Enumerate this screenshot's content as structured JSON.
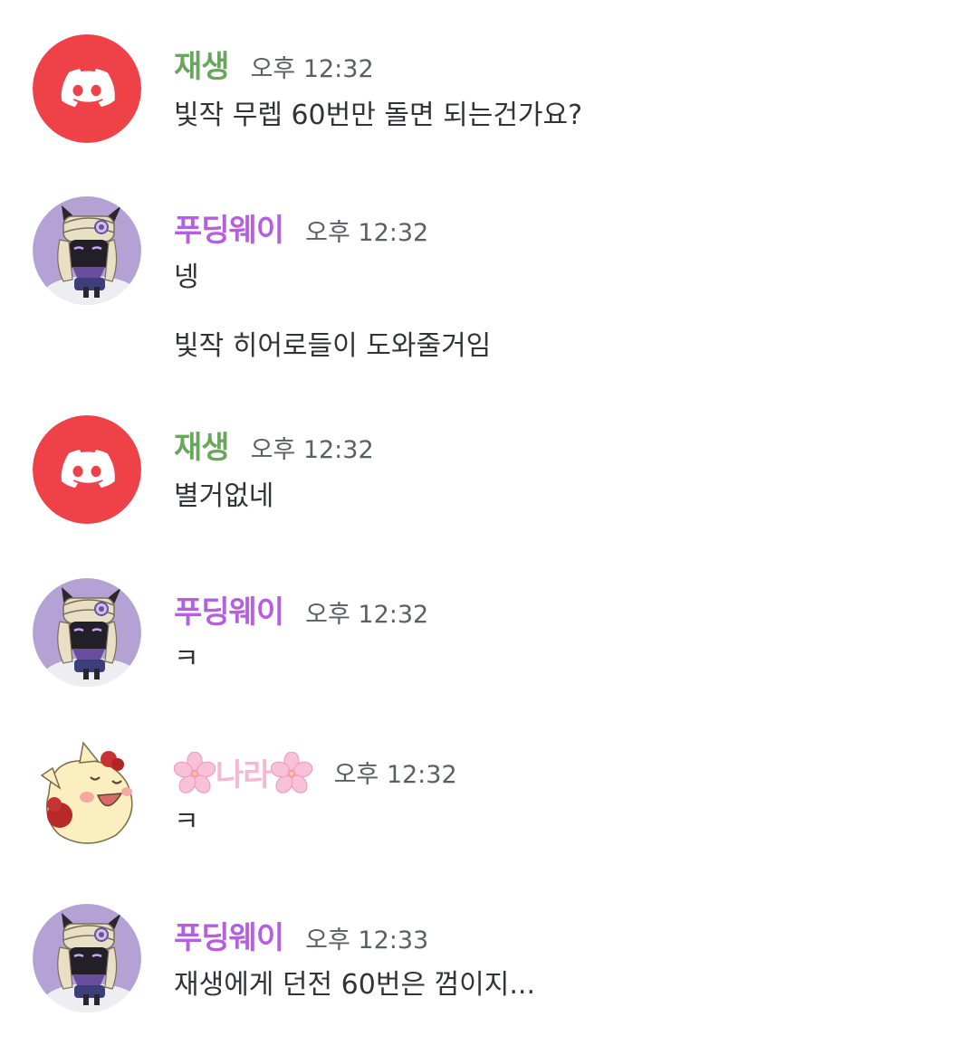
{
  "colors": {
    "jaesaeng_name": "#68a65c",
    "pudding_name": "#b45ee0",
    "nara_name": "#f4b9d1",
    "discord_avatar_bg": "#ee4148",
    "pudding_avatar_bg": "#b3a2d3",
    "nara_avatar_bg": "#f9efc0"
  },
  "messages": [
    {
      "author": "재생",
      "avatar": "discord-logo-icon",
      "time": "오후 12:32",
      "lines": [
        "빛작 무렙 60번만 돌면 되는건가요?"
      ]
    },
    {
      "author": "푸딩웨이",
      "avatar": "ninja-cat-avatar",
      "time": "오후 12:32",
      "lines": [
        "넹",
        "빛작 히어로들이 도와줄거임"
      ]
    },
    {
      "author": "재생",
      "avatar": "discord-logo-icon",
      "time": "오후 12:32",
      "lines": [
        "별거없네"
      ]
    },
    {
      "author": "푸딩웨이",
      "avatar": "ninja-cat-avatar",
      "time": "오후 12:32",
      "lines": [
        "ㅋ"
      ]
    },
    {
      "author": "나라",
      "author_decoration": "cherry-blossom-icon",
      "avatar": "yellow-cat-avatar",
      "time": "오후 12:32",
      "lines": [
        "ㅋ"
      ]
    },
    {
      "author": "푸딩웨이",
      "avatar": "ninja-cat-avatar",
      "time": "오후 12:33",
      "lines": [
        "재생에게 던전 60번은 껌이지..."
      ]
    }
  ]
}
